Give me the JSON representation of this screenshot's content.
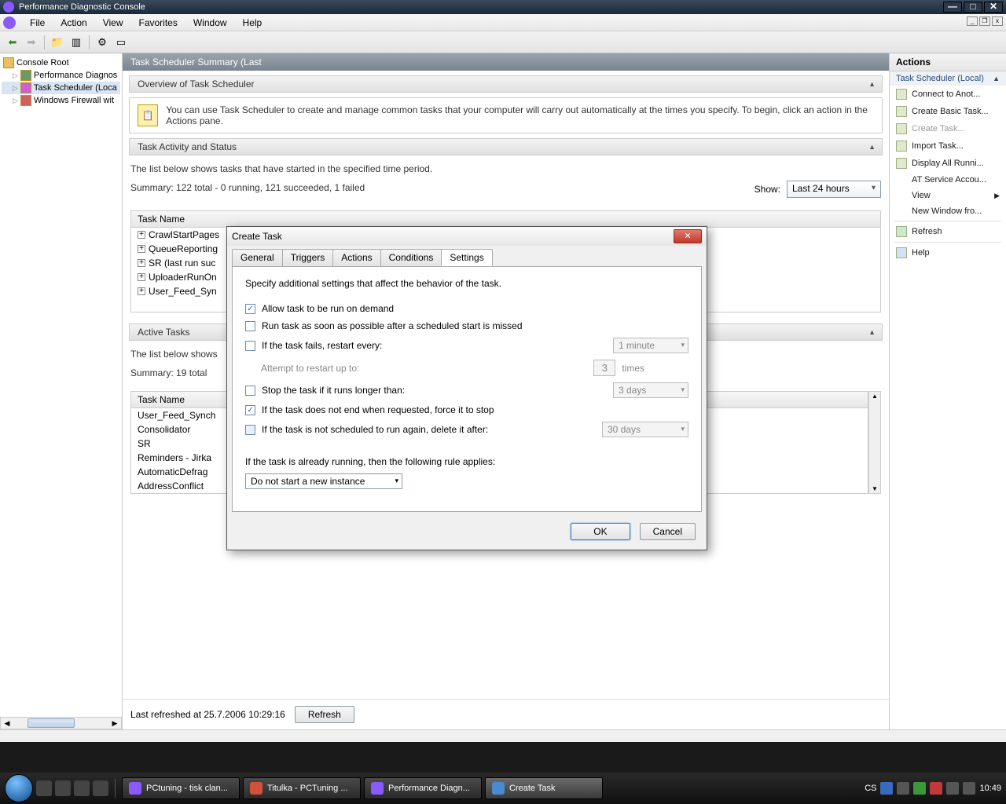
{
  "window": {
    "title": "Performance Diagnostic Console"
  },
  "menus": [
    "File",
    "Action",
    "View",
    "Favorites",
    "Window",
    "Help"
  ],
  "tree": {
    "root": "Console Root",
    "items": [
      "Performance Diagnos",
      "Task Scheduler  (Loca",
      "Windows Firewall wit"
    ]
  },
  "main": {
    "header": "Task Scheduler Summary (Last",
    "overview_title": "Overview of Task Scheduler",
    "overview_text": "You can use Task Scheduler to create and manage common tasks that your computer will carry out automatically at the times you specify. To begin, click an action in the Actions pane.",
    "status_title": "Task Activity and Status",
    "status_intro": "The list below shows tasks that have started in the specified time period.",
    "status_summary": "Summary: 122 total - 0 running, 121 succeeded, 1 failed",
    "show_label": "Show:",
    "show_value": "Last 24 hours",
    "task_name_header": "Task Name",
    "started_tasks": [
      "CrawlStartPages",
      "QueueReporting",
      "SR (last run suc",
      "UploaderRunOn",
      "User_Feed_Syn"
    ],
    "active_title": "Active Tasks",
    "active_intro": "The list below shows",
    "active_summary": "Summary: 19 total",
    "active_tasks": [
      "User_Feed_Synch",
      "Consolidator",
      "SR",
      "Reminders - Jirka",
      "AutomaticDefrag",
      "AddressConflict"
    ],
    "last_refreshed": "Last refreshed at 25.7.2006 10:29:16",
    "refresh_btn": "Refresh"
  },
  "actions": {
    "header": "Actions",
    "subheader": "Task Scheduler  (Local)",
    "items": [
      {
        "label": "Connect to Anot...",
        "icon": true
      },
      {
        "label": "Create Basic Task...",
        "icon": true
      },
      {
        "label": "Create Task...",
        "icon": true,
        "disabled": true
      },
      {
        "label": "Import Task...",
        "icon": true
      },
      {
        "label": "Display All Runni...",
        "icon": true
      },
      {
        "label": "AT Service Accou...",
        "icon": false
      },
      {
        "label": "View",
        "icon": false,
        "arrow": true
      },
      {
        "label": "New Window fro...",
        "icon": false
      },
      {
        "label": "Refresh",
        "icon": true
      },
      {
        "label": "Help",
        "icon": true
      }
    ]
  },
  "dialog": {
    "title": "Create Task",
    "tabs": [
      "General",
      "Triggers",
      "Actions",
      "Conditions",
      "Settings"
    ],
    "active_tab": "Settings",
    "intro": "Specify additional settings that affect the behavior of the task.",
    "opt_on_demand": "Allow task to be run on demand",
    "opt_run_missed": "Run task as soon as possible after a scheduled start is missed",
    "opt_restart": "If the task fails, restart every:",
    "restart_interval": "1  minute",
    "attempt_label": "Attempt to restart up to:",
    "attempt_count": "3",
    "attempt_times": "times",
    "opt_stop_longer": "Stop the task if it runs longer than:",
    "stop_longer_value": "3  days",
    "opt_force_stop": "If the task does not end when requested, force it to stop",
    "opt_delete_after": "If the task is not scheduled to run again, delete it after:",
    "delete_after_value": "30  days",
    "rule_label": "If the task is already running, then the following rule applies:",
    "rule_value": "Do not start a new instance",
    "ok": "OK",
    "cancel": "Cancel"
  },
  "taskbar": {
    "items": [
      "PCtuning - tisk clan...",
      "Titulka - PCTuning ...",
      "Performance Diagn...",
      "Create Task"
    ],
    "lang": "CS",
    "clock": "10:49"
  }
}
